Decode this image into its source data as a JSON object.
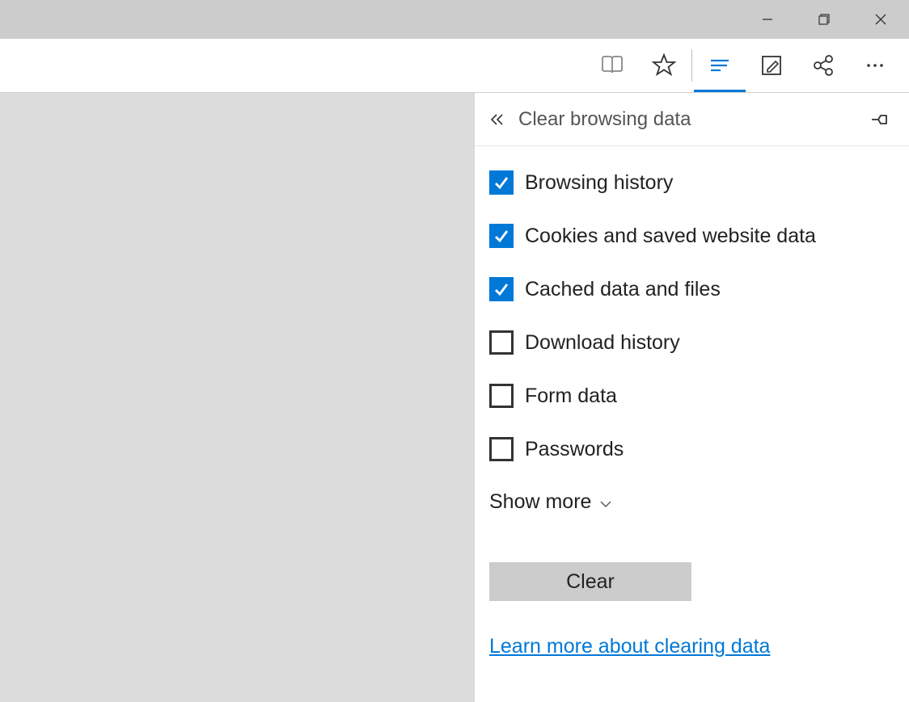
{
  "panel": {
    "title": "Clear browsing data",
    "show_more_label": "Show more",
    "clear_button_label": "Clear",
    "learn_more_label": "Learn more about clearing data"
  },
  "options": [
    {
      "label": "Browsing history",
      "checked": true
    },
    {
      "label": "Cookies and saved website data",
      "checked": true
    },
    {
      "label": "Cached data and files",
      "checked": true
    },
    {
      "label": "Download history",
      "checked": false
    },
    {
      "label": "Form data",
      "checked": false
    },
    {
      "label": "Passwords",
      "checked": false
    }
  ],
  "colors": {
    "accent": "#0078d7",
    "link": "#0078d7"
  }
}
